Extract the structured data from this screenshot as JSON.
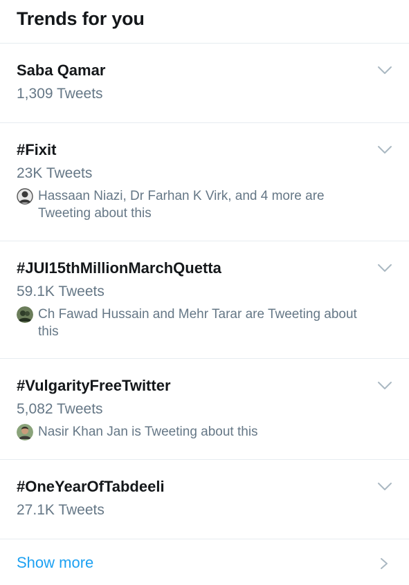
{
  "header": {
    "title": "Trends for you"
  },
  "trends": [
    {
      "name": "Saba Qamar",
      "count": "1,309 Tweets"
    },
    {
      "name": "#Fixit",
      "count": "23K Tweets",
      "context": "Hassaan Niazi, Dr Farhan K Virk, and 4 more are Tweeting about this",
      "avatar_icon": "user-avatar-icon"
    },
    {
      "name": "#JUI15thMillionMarchQuetta",
      "count": "59.1K Tweets",
      "context": "Ch Fawad Hussain and Mehr Tarar are Tweeting about this",
      "avatar_icon": "user-avatar-icon"
    },
    {
      "name": "#VulgarityFreeTwitter",
      "count": "5,082 Tweets",
      "context": "Nasir Khan Jan is Tweeting about this",
      "avatar_icon": "user-avatar-icon"
    },
    {
      "name": "#OneYearOfTabdeeli",
      "count": "27.1K Tweets"
    }
  ],
  "footer": {
    "show_more_label": "Show more"
  },
  "colors": {
    "accent": "#1da1f2",
    "secondary_text": "#657786",
    "primary_text": "#14171a",
    "divider": "#e6ecf0"
  }
}
